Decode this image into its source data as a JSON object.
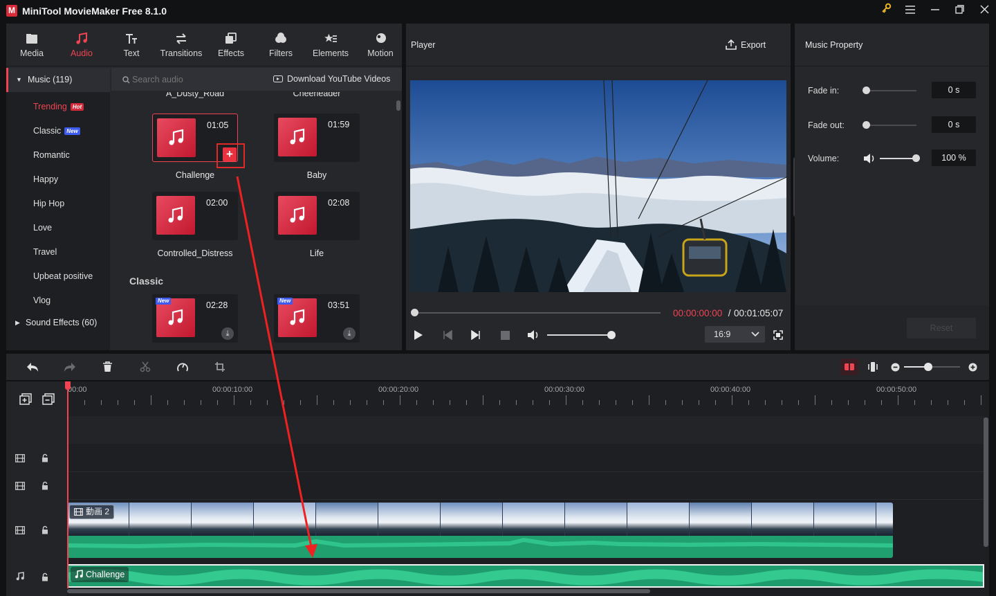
{
  "app": {
    "title": "MiniTool MovieMaker Free 8.1.0",
    "logo_letter": "M",
    "accent": "#ef4452"
  },
  "window_controls": [
    "key-icon",
    "menu-icon",
    "minimize-icon",
    "maximize-icon",
    "close-icon"
  ],
  "library": {
    "tabs": [
      {
        "label": "Media",
        "icon": "media-icon"
      },
      {
        "label": "Audio",
        "icon": "audio-icon",
        "active": true
      },
      {
        "label": "Text",
        "icon": "text-icon"
      },
      {
        "label": "Transitions",
        "icon": "transitions-icon"
      },
      {
        "label": "Effects",
        "icon": "effects-icon"
      },
      {
        "label": "Filters",
        "icon": "filters-icon"
      },
      {
        "label": "Elements",
        "icon": "elements-icon"
      },
      {
        "label": "Motion",
        "icon": "motion-icon"
      }
    ],
    "music_group": "Music (119)",
    "categories": [
      {
        "label": "Trending",
        "badge": "Hot",
        "active": true
      },
      {
        "label": "Classic",
        "badge": "New"
      },
      {
        "label": "Romantic"
      },
      {
        "label": "Happy"
      },
      {
        "label": "Hip Hop"
      },
      {
        "label": "Love"
      },
      {
        "label": "Travel"
      },
      {
        "label": "Upbeat positive"
      },
      {
        "label": "Vlog"
      }
    ],
    "sound_effects_group": "Sound Effects (60)",
    "search_placeholder": "Search audio",
    "download_label": "Download YouTube Videos",
    "partial_names": [
      "A_Dusty_Road",
      "Cheerleader"
    ],
    "tracks": [
      {
        "name": "Challenge",
        "duration": "01:05",
        "selected": true
      },
      {
        "name": "Baby",
        "duration": "01:59"
      },
      {
        "name": "Controlled_Distress",
        "duration": "02:00"
      },
      {
        "name": "Life",
        "duration": "02:08"
      }
    ],
    "classic_heading": "Classic",
    "classic_tracks": [
      {
        "duration": "02:28",
        "tag": "New"
      },
      {
        "duration": "03:51",
        "tag": "New"
      }
    ]
  },
  "player": {
    "title": "Player",
    "export_label": "Export",
    "current_time": "00:00:00:00",
    "separator": " / ",
    "total_time": "00:01:05:07",
    "aspect_ratio": "16:9",
    "volume_level": 0.9,
    "progress": 0
  },
  "music_property": {
    "title": "Music Property",
    "fade_in": {
      "label": "Fade in:",
      "value": "0 s",
      "level": 0
    },
    "fade_out": {
      "label": "Fade out:",
      "value": "0 s",
      "level": 0
    },
    "volume": {
      "label": "Volume:",
      "value": "100 %",
      "level": 1.0
    },
    "reset_label": "Reset"
  },
  "timeline": {
    "ruler_labels": [
      "00:00",
      "00:00:10:00",
      "00:00:20:00",
      "00:00:30:00",
      "00:00:40:00",
      "00:00:50:00"
    ],
    "video_clip_label": "動画 2",
    "music_clip_label": "Challenge",
    "zoom_level": 0.3
  }
}
